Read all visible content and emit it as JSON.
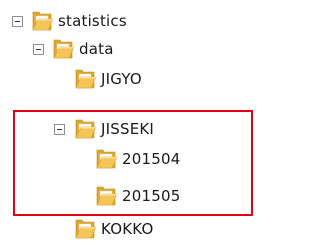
{
  "tree": {
    "items": [
      {
        "label": "statistics",
        "expanded": true,
        "level": 0
      },
      {
        "label": "data",
        "expanded": true,
        "level": 1
      },
      {
        "label": "JIGYO",
        "expanded": false,
        "level": 2
      },
      {
        "label": "JISSEKI",
        "expanded": true,
        "level": 2
      },
      {
        "label": "201504",
        "expanded": false,
        "level": 3
      },
      {
        "label": "201505",
        "expanded": false,
        "level": 3
      },
      {
        "label": "KOKKO",
        "expanded": false,
        "level": 2
      }
    ]
  },
  "colors": {
    "highlight": "#e60012",
    "folder_front": "#f5c558",
    "folder_back": "#e0a62a",
    "folder_paper": "#ffffff"
  },
  "icons": {
    "toggle": "collapse-toggle-icon",
    "folder": "folder-icon"
  }
}
